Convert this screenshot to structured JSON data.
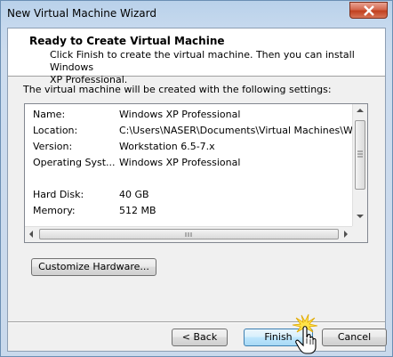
{
  "window": {
    "title": "New Virtual Machine Wizard"
  },
  "header": {
    "title": "Ready to Create Virtual Machine",
    "description_line1": "Click Finish to create the virtual machine. Then you can install Windows",
    "description_line2": "XP Professional."
  },
  "settings": {
    "intro": "The virtual machine will be created with the following settings:",
    "rows": [
      {
        "key": "Name:",
        "value": "Windows XP Professional"
      },
      {
        "key": "Location:",
        "value": "C:\\Users\\NASER\\Documents\\Virtual Machines\\Win..."
      },
      {
        "key": "Version:",
        "value": "Workstation 6.5-7.x"
      },
      {
        "key": "Operating Syst...",
        "value": "Windows XP Professional"
      },
      {
        "key": "",
        "value": ""
      },
      {
        "key": "Hard Disk:",
        "value": "40 GB"
      },
      {
        "key": "Memory:",
        "value": "512 MB"
      }
    ]
  },
  "buttons": {
    "customize": "Customize Hardware...",
    "back": "< Back",
    "finish": "Finish",
    "cancel": "Cancel"
  },
  "icons": {
    "close": "close-icon",
    "cursor": "hand-pointer-icon"
  }
}
